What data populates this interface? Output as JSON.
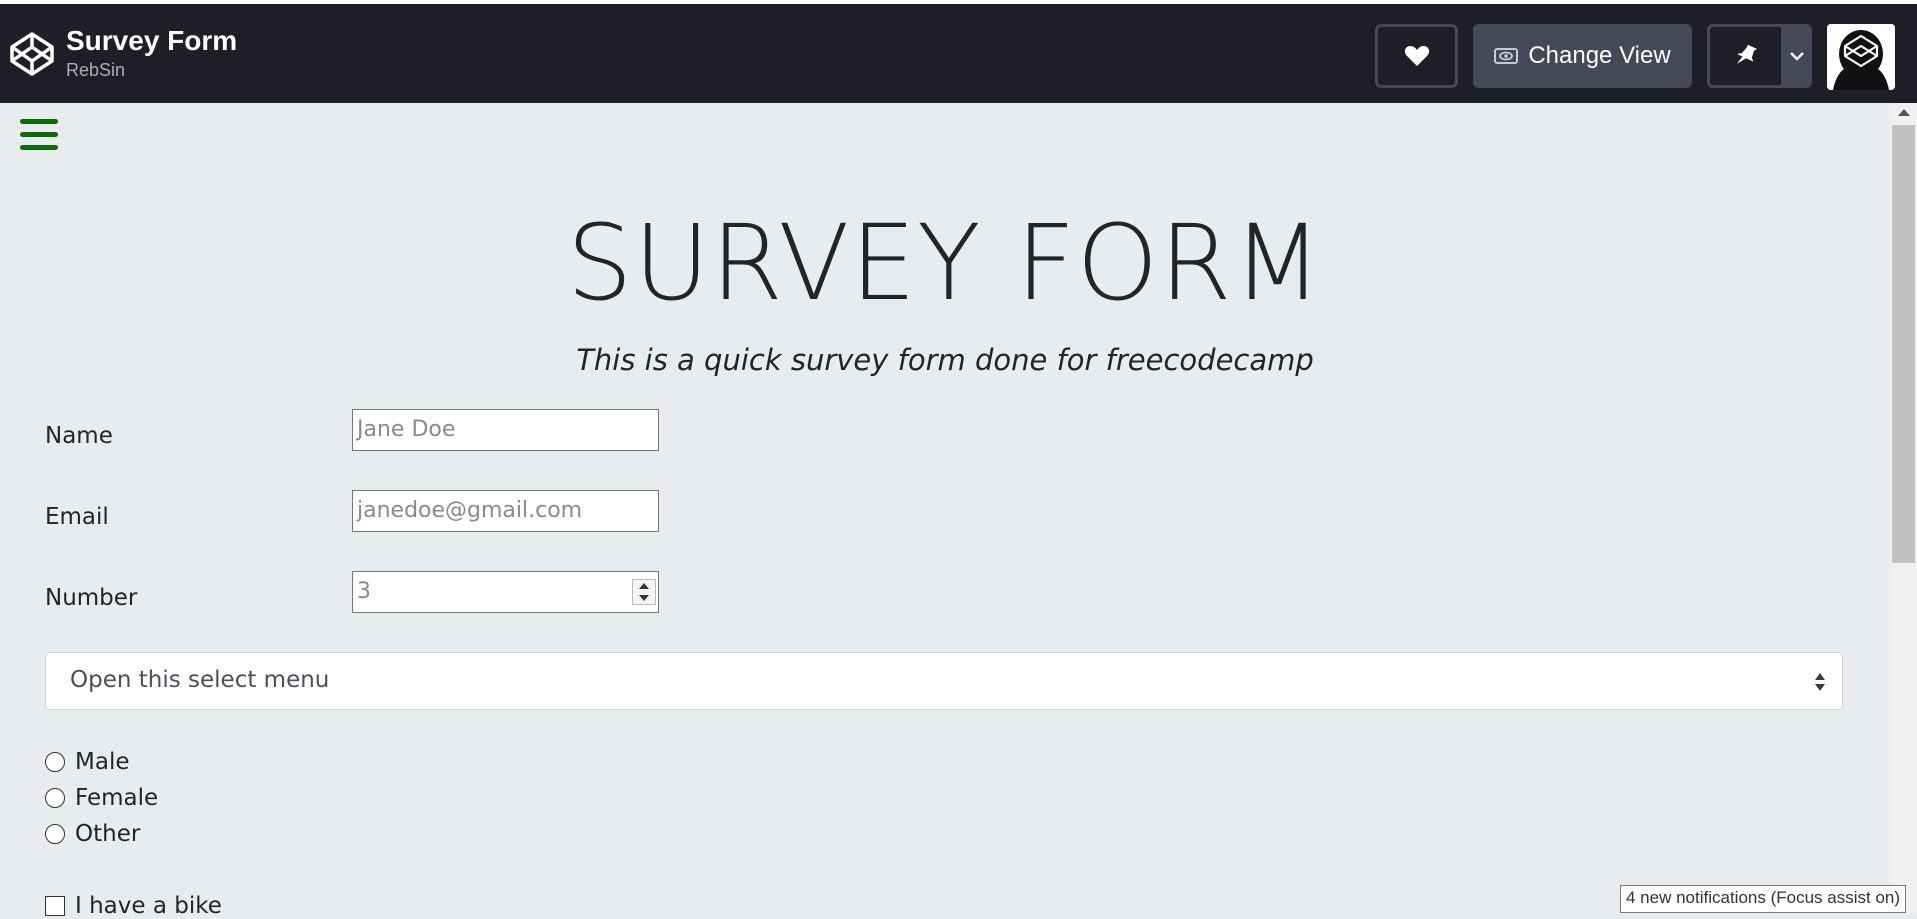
{
  "header": {
    "title": "Survey Form",
    "author": "RebSin",
    "change_view_label": "Change View",
    "icons": [
      "codepen-logo-icon",
      "heart-icon",
      "eye-icon",
      "pin-icon",
      "chevron-down-icon"
    ]
  },
  "page": {
    "heading": "SURVEY FORM",
    "subtitle": "This is a quick survey form done for freecodecamp",
    "fields": {
      "name_label": "Name",
      "name_placeholder": "Jane Doe",
      "email_label": "Email",
      "email_placeholder": "janedoe@gmail.com",
      "number_label": "Number",
      "number_value": "3"
    },
    "select": {
      "selected": "Open this select menu"
    },
    "radios": [
      "Male",
      "Female",
      "Other"
    ],
    "checkboxes": [
      "I have a bike"
    ]
  },
  "system": {
    "notification": "4 new notifications (Focus assist on)"
  },
  "colors": {
    "topbar": "#1e1f26",
    "page_bg": "#e9ecef",
    "hamburger": "#0b6b0b",
    "button_dark": "#444857"
  }
}
